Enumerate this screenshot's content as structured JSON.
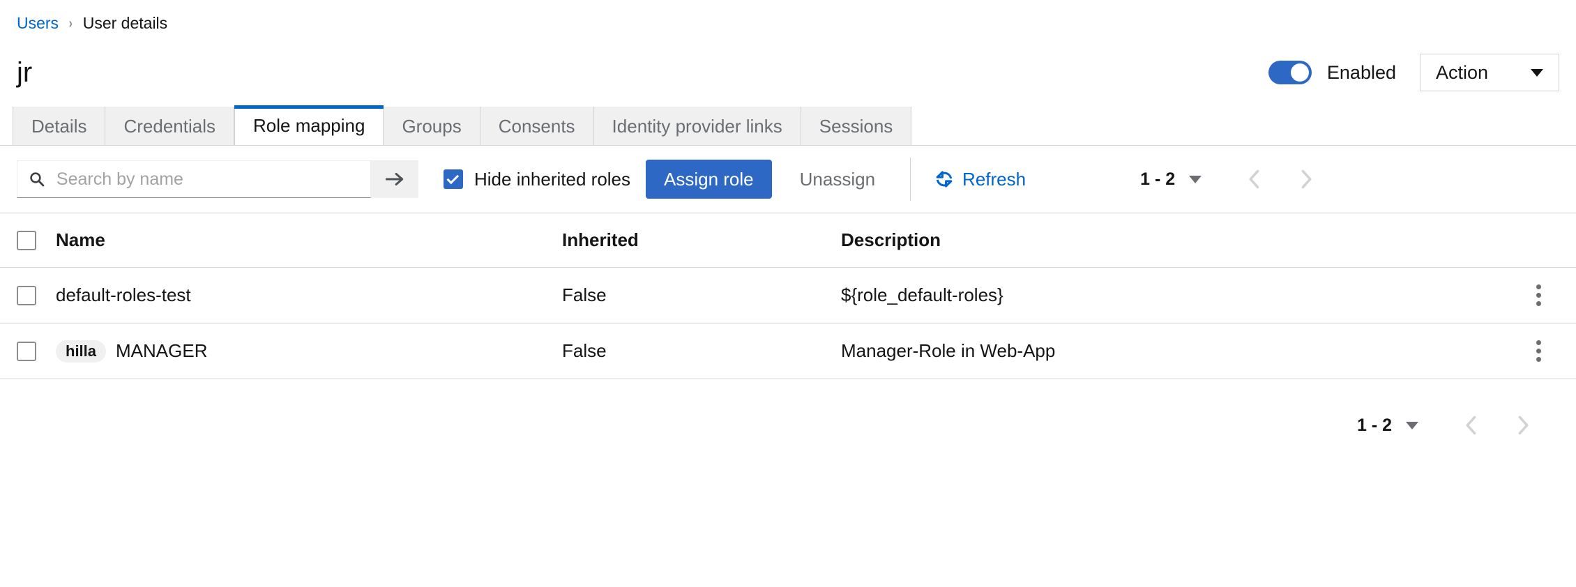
{
  "breadcrumb": {
    "parent_label": "Users",
    "separator": "›",
    "current_label": "User details"
  },
  "header": {
    "title": "jr",
    "toggle": {
      "state_label": "Enabled",
      "enabled": true,
      "on_color": "#2d68c4"
    },
    "action_button": {
      "label": "Action",
      "caret_icon": "caret-down-icon"
    }
  },
  "tabs": {
    "active_index": 2,
    "active_accent": "#0066cc",
    "items": [
      {
        "label": "Details"
      },
      {
        "label": "Credentials"
      },
      {
        "label": "Role mapping"
      },
      {
        "label": "Groups"
      },
      {
        "label": "Consents"
      },
      {
        "label": "Identity provider links"
      },
      {
        "label": "Sessions"
      }
    ]
  },
  "toolbar": {
    "search": {
      "icon": "search-icon",
      "value": "",
      "placeholder": "Search by name",
      "submit_icon": "arrow-right-icon"
    },
    "hide_inherited": {
      "label": "Hide inherited roles",
      "checked": true
    },
    "assign_role_label": "Assign role",
    "unassign_label": "Unassign",
    "refresh": {
      "label": "Refresh",
      "icon": "refresh-icon",
      "color": "#0066cc"
    }
  },
  "pagination_top": {
    "range": "1 - 2",
    "caret_icon": "caret-down-icon",
    "prev_icon": "chevron-left-icon",
    "next_icon": "chevron-right-icon",
    "prev_disabled": true,
    "next_disabled": true
  },
  "pagination_bottom": {
    "range": "1 - 2",
    "caret_icon": "caret-down-icon",
    "prev_icon": "chevron-left-icon",
    "next_icon": "chevron-right-icon",
    "prev_disabled": true,
    "next_disabled": true
  },
  "table": {
    "select_all_checked": false,
    "columns": {
      "name": "Name",
      "inherited": "Inherited",
      "description": "Description"
    },
    "rows": [
      {
        "checked": false,
        "badge": "",
        "name": "default-roles-test",
        "inherited": "False",
        "description": "${role_default-roles}",
        "kebab_icon": "kebab-menu-icon"
      },
      {
        "checked": false,
        "badge": "hilla",
        "name": "MANAGER",
        "inherited": "False",
        "description": "Manager-Role in Web-App",
        "kebab_icon": "kebab-menu-icon"
      }
    ]
  }
}
